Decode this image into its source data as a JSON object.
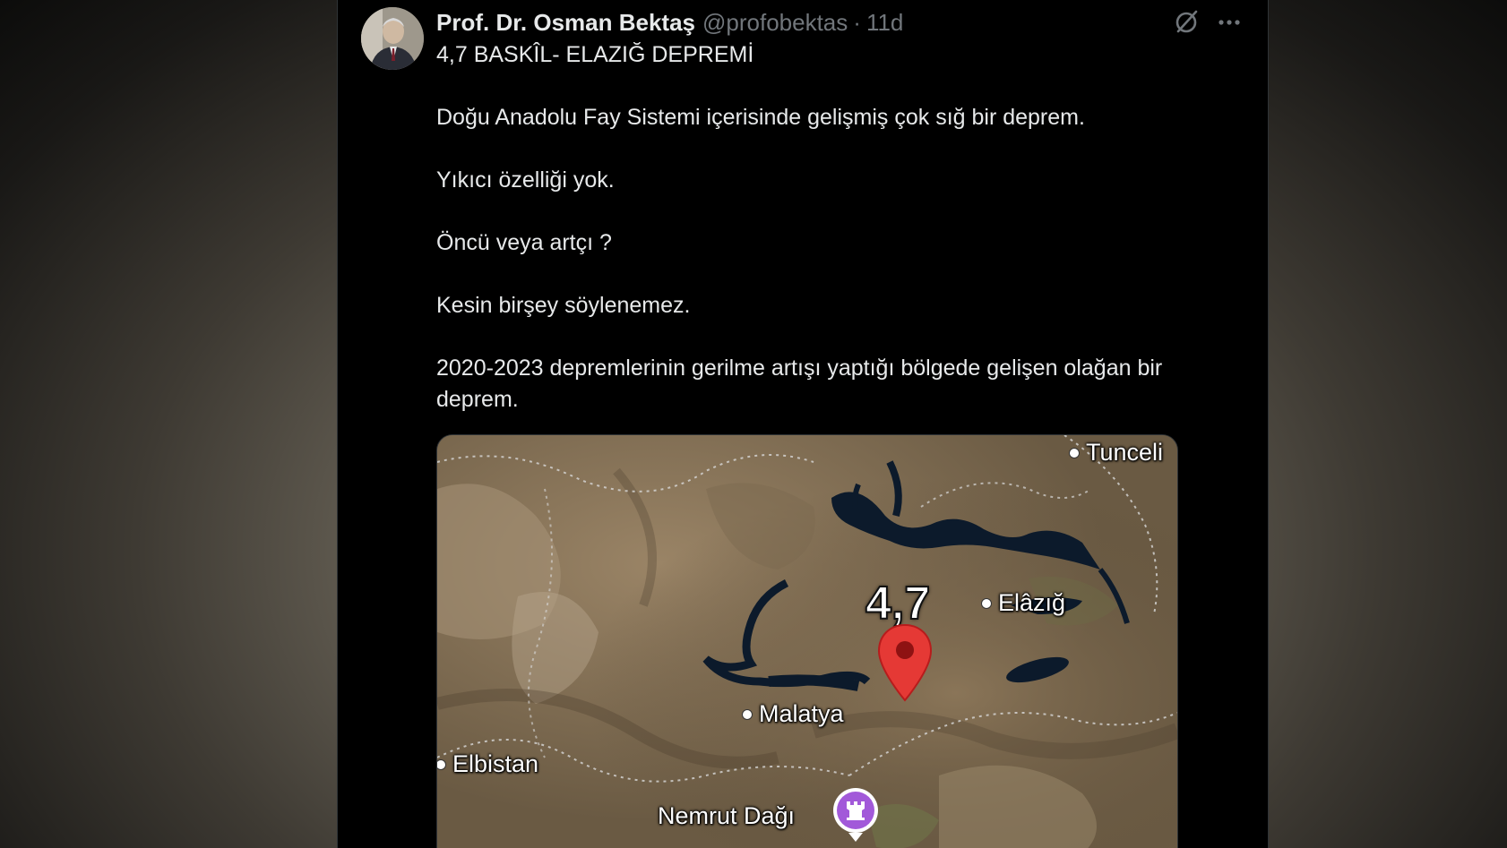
{
  "tweet": {
    "author_name": "Prof. Dr. Osman Bektaş",
    "handle": "@profobektas",
    "separator": "·",
    "time": "11d",
    "paragraphs": [
      "4,7 BASKÎL- ELAZIĞ DEPREMİ",
      "Doğu Anadolu Fay Sistemi içerisinde gelişmiş çok sığ bir deprem.",
      "Yıkıcı özelliği yok.",
      "Öncü veya artçı ?",
      "Kesin birşey söylenemez.",
      "2020-2023 depremlerinin gerilme artışı yaptığı bölgede gelişen olağan bir deprem."
    ]
  },
  "map": {
    "magnitude": "4,7",
    "places": {
      "tunceli": "Tunceli",
      "elazig": "Elâzığ",
      "malatya": "Malatya",
      "elbistan": "Elbistan",
      "nemrut": "Nemrut Dağı"
    },
    "marker_color": "#e53935",
    "poi_color": "#a259d9"
  },
  "icons": {
    "grok": "grok-icon",
    "more": "more-icon",
    "marker": "map-pin-icon",
    "poi": "castle-poi-icon"
  }
}
